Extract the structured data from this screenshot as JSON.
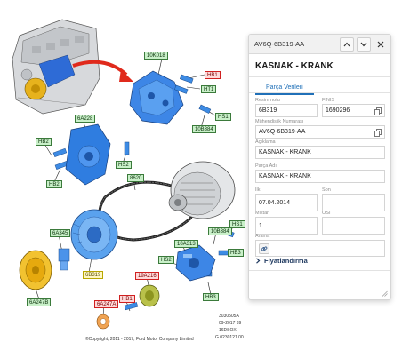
{
  "diagram": {
    "callouts": [
      {
        "text": "10K018",
        "style": "green"
      },
      {
        "text": "HB1",
        "style": "red"
      },
      {
        "text": "HT1",
        "style": "green"
      },
      {
        "text": "HS1",
        "style": "green"
      },
      {
        "text": "10B384",
        "style": "green"
      },
      {
        "text": "6A228",
        "style": "green"
      },
      {
        "text": "HB2",
        "style": "green"
      },
      {
        "text": "HB2",
        "style": "green"
      },
      {
        "text": "HS2",
        "style": "green"
      },
      {
        "text": "8620",
        "style": "green"
      },
      {
        "text": "6A345",
        "style": "green"
      },
      {
        "text": "6B319",
        "style": "yellow"
      },
      {
        "text": "10A313",
        "style": "green"
      },
      {
        "text": "10B384",
        "style": "green"
      },
      {
        "text": "HS1",
        "style": "green"
      },
      {
        "text": "HB3",
        "style": "green"
      },
      {
        "text": "HS2",
        "style": "green"
      },
      {
        "text": "19A216",
        "style": "red"
      },
      {
        "text": "HB3",
        "style": "green"
      },
      {
        "text": "HB1",
        "style": "red"
      },
      {
        "text": "6A247A",
        "style": "red"
      },
      {
        "text": "6A247B",
        "style": "green"
      }
    ],
    "drawing_refs": [
      "3030505A",
      "09-2017 39",
      "16DSOX",
      "G 0230121 00"
    ],
    "copyright": "©Copyright, 2011 - 2017, Ford Motor Company Limited"
  },
  "panel": {
    "part_code": "AV6Q-6B319-AA",
    "title": "KASNAK - KRANK",
    "tab": "Parça Verileri",
    "fields": {
      "resim_notu": {
        "label": "Resim notu",
        "value": "6B319"
      },
      "finis": {
        "label": "FINIS",
        "value": "1690296"
      },
      "muhendislik": {
        "label": "Mühendislik Numarası",
        "value": "AV6Q-6B319-AA"
      },
      "aciklama": {
        "label": "Açıklama",
        "value": "KASNAK - KRANK"
      },
      "parca_adi": {
        "label": "Parça Adı",
        "value": "KASNAK - KRANK"
      },
      "ilk": {
        "label": "İlk",
        "value": "07.04.2014"
      },
      "son": {
        "label": "Son",
        "value": ""
      },
      "miktar": {
        "label": "Miktar",
        "value": "1"
      },
      "osi": {
        "label": "OSI",
        "value": ""
      },
      "arama": {
        "label": "Arama",
        "value": ""
      }
    },
    "price_section": "Fiyatlandırma",
    "icons": [
      "chevron-up-icon",
      "chevron-down-icon",
      "close-icon",
      "copy-icon",
      "link-icon",
      "chevron-right-icon",
      "resize-grip-icon"
    ]
  }
}
